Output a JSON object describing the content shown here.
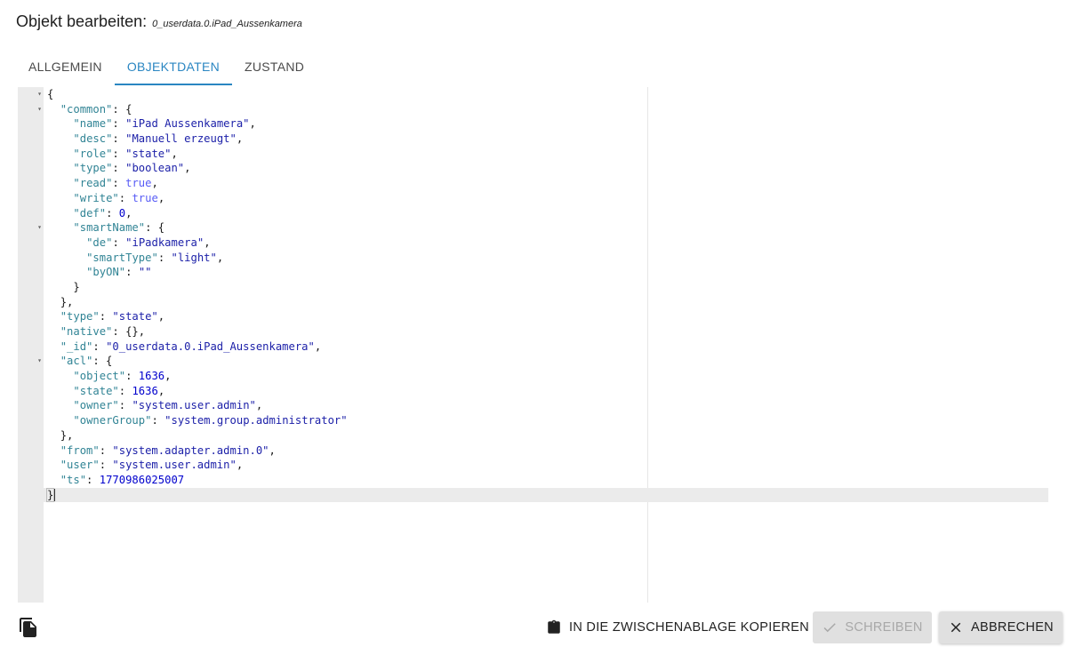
{
  "dialog": {
    "title": "Objekt bearbeiten:",
    "object_id": "0_userdata.0.iPad_Aussenkamera"
  },
  "tabs": [
    {
      "label": "ALLGEMEIN",
      "active": false
    },
    {
      "label": "OBJEKTDATEN",
      "active": true
    },
    {
      "label": "ZUSTAND",
      "active": false
    }
  ],
  "editor": {
    "lines": [
      {
        "indent": 0,
        "fold": true,
        "tokens": [
          {
            "t": "p",
            "v": "{"
          }
        ]
      },
      {
        "indent": 1,
        "fold": true,
        "tokens": [
          {
            "t": "k",
            "v": "\"common\""
          },
          {
            "t": "p",
            "v": ": {"
          }
        ]
      },
      {
        "indent": 2,
        "tokens": [
          {
            "t": "k",
            "v": "\"name\""
          },
          {
            "t": "p",
            "v": ": "
          },
          {
            "t": "s",
            "v": "\"iPad Aussenkamera\""
          },
          {
            "t": "p",
            "v": ","
          }
        ]
      },
      {
        "indent": 2,
        "tokens": [
          {
            "t": "k",
            "v": "\"desc\""
          },
          {
            "t": "p",
            "v": ": "
          },
          {
            "t": "s",
            "v": "\"Manuell erzeugt\""
          },
          {
            "t": "p",
            "v": ","
          }
        ]
      },
      {
        "indent": 2,
        "tokens": [
          {
            "t": "k",
            "v": "\"role\""
          },
          {
            "t": "p",
            "v": ": "
          },
          {
            "t": "s",
            "v": "\"state\""
          },
          {
            "t": "p",
            "v": ","
          }
        ]
      },
      {
        "indent": 2,
        "tokens": [
          {
            "t": "k",
            "v": "\"type\""
          },
          {
            "t": "p",
            "v": ": "
          },
          {
            "t": "s",
            "v": "\"boolean\""
          },
          {
            "t": "p",
            "v": ","
          }
        ]
      },
      {
        "indent": 2,
        "tokens": [
          {
            "t": "k",
            "v": "\"read\""
          },
          {
            "t": "p",
            "v": ": "
          },
          {
            "t": "b",
            "v": "true"
          },
          {
            "t": "p",
            "v": ","
          }
        ]
      },
      {
        "indent": 2,
        "tokens": [
          {
            "t": "k",
            "v": "\"write\""
          },
          {
            "t": "p",
            "v": ": "
          },
          {
            "t": "b",
            "v": "true"
          },
          {
            "t": "p",
            "v": ","
          }
        ]
      },
      {
        "indent": 2,
        "tokens": [
          {
            "t": "k",
            "v": "\"def\""
          },
          {
            "t": "p",
            "v": ": "
          },
          {
            "t": "n",
            "v": "0"
          },
          {
            "t": "p",
            "v": ","
          }
        ]
      },
      {
        "indent": 2,
        "fold": true,
        "tokens": [
          {
            "t": "k",
            "v": "\"smartName\""
          },
          {
            "t": "p",
            "v": ": {"
          }
        ]
      },
      {
        "indent": 3,
        "tokens": [
          {
            "t": "k",
            "v": "\"de\""
          },
          {
            "t": "p",
            "v": ": "
          },
          {
            "t": "s",
            "v": "\"iPadkamera\""
          },
          {
            "t": "p",
            "v": ","
          }
        ]
      },
      {
        "indent": 3,
        "tokens": [
          {
            "t": "k",
            "v": "\"smartType\""
          },
          {
            "t": "p",
            "v": ": "
          },
          {
            "t": "s",
            "v": "\"light\""
          },
          {
            "t": "p",
            "v": ","
          }
        ]
      },
      {
        "indent": 3,
        "tokens": [
          {
            "t": "k",
            "v": "\"byON\""
          },
          {
            "t": "p",
            "v": ": "
          },
          {
            "t": "s",
            "v": "\"\""
          }
        ]
      },
      {
        "indent": 2,
        "tokens": [
          {
            "t": "p",
            "v": "}"
          }
        ]
      },
      {
        "indent": 1,
        "tokens": [
          {
            "t": "p",
            "v": "},"
          }
        ]
      },
      {
        "indent": 1,
        "tokens": [
          {
            "t": "k",
            "v": "\"type\""
          },
          {
            "t": "p",
            "v": ": "
          },
          {
            "t": "s",
            "v": "\"state\""
          },
          {
            "t": "p",
            "v": ","
          }
        ]
      },
      {
        "indent": 1,
        "tokens": [
          {
            "t": "k",
            "v": "\"native\""
          },
          {
            "t": "p",
            "v": ": {},"
          }
        ]
      },
      {
        "indent": 1,
        "tokens": [
          {
            "t": "k",
            "v": "\"_id\""
          },
          {
            "t": "p",
            "v": ": "
          },
          {
            "t": "s",
            "v": "\"0_userdata.0.iPad_Aussenkamera\""
          },
          {
            "t": "p",
            "v": ","
          }
        ]
      },
      {
        "indent": 1,
        "fold": true,
        "tokens": [
          {
            "t": "k",
            "v": "\"acl\""
          },
          {
            "t": "p",
            "v": ": {"
          }
        ]
      },
      {
        "indent": 2,
        "tokens": [
          {
            "t": "k",
            "v": "\"object\""
          },
          {
            "t": "p",
            "v": ": "
          },
          {
            "t": "n",
            "v": "1636"
          },
          {
            "t": "p",
            "v": ","
          }
        ]
      },
      {
        "indent": 2,
        "tokens": [
          {
            "t": "k",
            "v": "\"state\""
          },
          {
            "t": "p",
            "v": ": "
          },
          {
            "t": "n",
            "v": "1636"
          },
          {
            "t": "p",
            "v": ","
          }
        ]
      },
      {
        "indent": 2,
        "tokens": [
          {
            "t": "k",
            "v": "\"owner\""
          },
          {
            "t": "p",
            "v": ": "
          },
          {
            "t": "s",
            "v": "\"system.user.admin\""
          },
          {
            "t": "p",
            "v": ","
          }
        ]
      },
      {
        "indent": 2,
        "tokens": [
          {
            "t": "k",
            "v": "\"ownerGroup\""
          },
          {
            "t": "p",
            "v": ": "
          },
          {
            "t": "s",
            "v": "\"system.group.administrator\""
          }
        ]
      },
      {
        "indent": 1,
        "tokens": [
          {
            "t": "p",
            "v": "},"
          }
        ]
      },
      {
        "indent": 1,
        "tokens": [
          {
            "t": "k",
            "v": "\"from\""
          },
          {
            "t": "p",
            "v": ": "
          },
          {
            "t": "s",
            "v": "\"system.adapter.admin.0\""
          },
          {
            "t": "p",
            "v": ","
          }
        ]
      },
      {
        "indent": 1,
        "tokens": [
          {
            "t": "k",
            "v": "\"user\""
          },
          {
            "t": "p",
            "v": ": "
          },
          {
            "t": "s",
            "v": "\"system.user.admin\""
          },
          {
            "t": "p",
            "v": ","
          }
        ]
      },
      {
        "indent": 1,
        "tokens": [
          {
            "t": "k",
            "v": "\"ts\""
          },
          {
            "t": "p",
            "v": ": "
          },
          {
            "t": "n",
            "v": "1770986025007"
          }
        ]
      },
      {
        "indent": 0,
        "active": true,
        "tokens": [
          {
            "t": "p",
            "v": "}"
          }
        ]
      }
    ]
  },
  "footer": {
    "copy_icon": "copy-files-icon",
    "clipboard_label": "IN DIE ZWISCHENABLAGE KOPIEREN",
    "clipboard_icon": "clipboard-icon",
    "write_label": "SCHREIBEN",
    "write_icon": "check-icon",
    "write_disabled": true,
    "cancel_label": "ABBRECHEN",
    "cancel_icon": "close-icon"
  },
  "colors": {
    "accent": "#2a86c2",
    "json_key": "#318495",
    "json_string": "#1b1fa8",
    "json_number": "#0000cd",
    "json_boolean": "#585cf6",
    "gutter": "#ebebeb"
  }
}
